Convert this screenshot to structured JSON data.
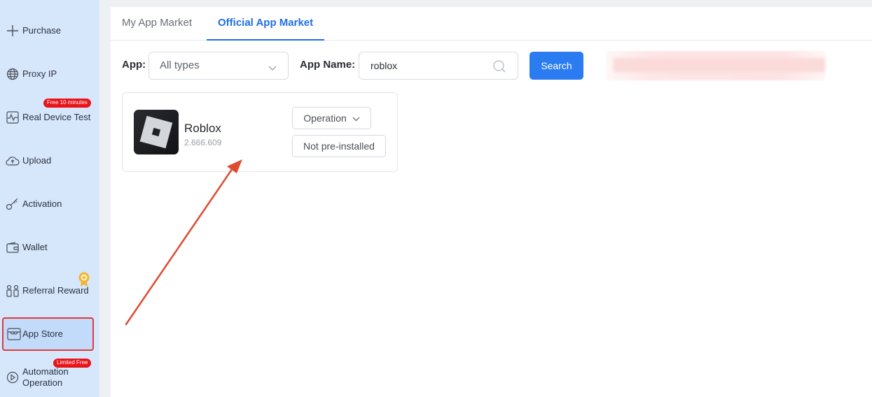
{
  "sidebar": {
    "items": [
      {
        "label": "Purchase",
        "icon": "plus-icon"
      },
      {
        "label": "Proxy IP",
        "icon": "globe-icon"
      },
      {
        "label": "Real Device Test",
        "icon": "pulse-icon",
        "badge": "Free 10 minutes"
      },
      {
        "label": "Upload",
        "icon": "cloud-upload-icon"
      },
      {
        "label": "Activation",
        "icon": "key-icon"
      },
      {
        "label": "Wallet",
        "icon": "wallet-icon"
      },
      {
        "label": "Referral Reward",
        "icon": "people-icon"
      },
      {
        "label": "App Store",
        "icon": "store-icon",
        "active": true
      },
      {
        "label": "Automation Operation",
        "icon": "play-circle-icon",
        "badge": "Limited Free"
      }
    ],
    "medal_icon": "medal-icon"
  },
  "tabs": [
    {
      "label": "My App Market",
      "active": false
    },
    {
      "label": "Official App Market",
      "active": true
    }
  ],
  "filters": {
    "app_label": "App:",
    "app_type_value": "All types",
    "app_name_label": "App Name:",
    "app_name_value": "roblox",
    "search_button": "Search"
  },
  "results": [
    {
      "name": "Roblox",
      "version": "2.666.609",
      "operation_button": "Operation",
      "status_button": "Not pre-installed"
    }
  ],
  "colors": {
    "sidebar_bg": "#d6e6fb",
    "accent": "#1f6fe5",
    "primary_button": "#2a7cf0",
    "highlight_border": "#e03a3a",
    "badge": "#e8141a",
    "annotation_arrow": "#e04a2f"
  }
}
